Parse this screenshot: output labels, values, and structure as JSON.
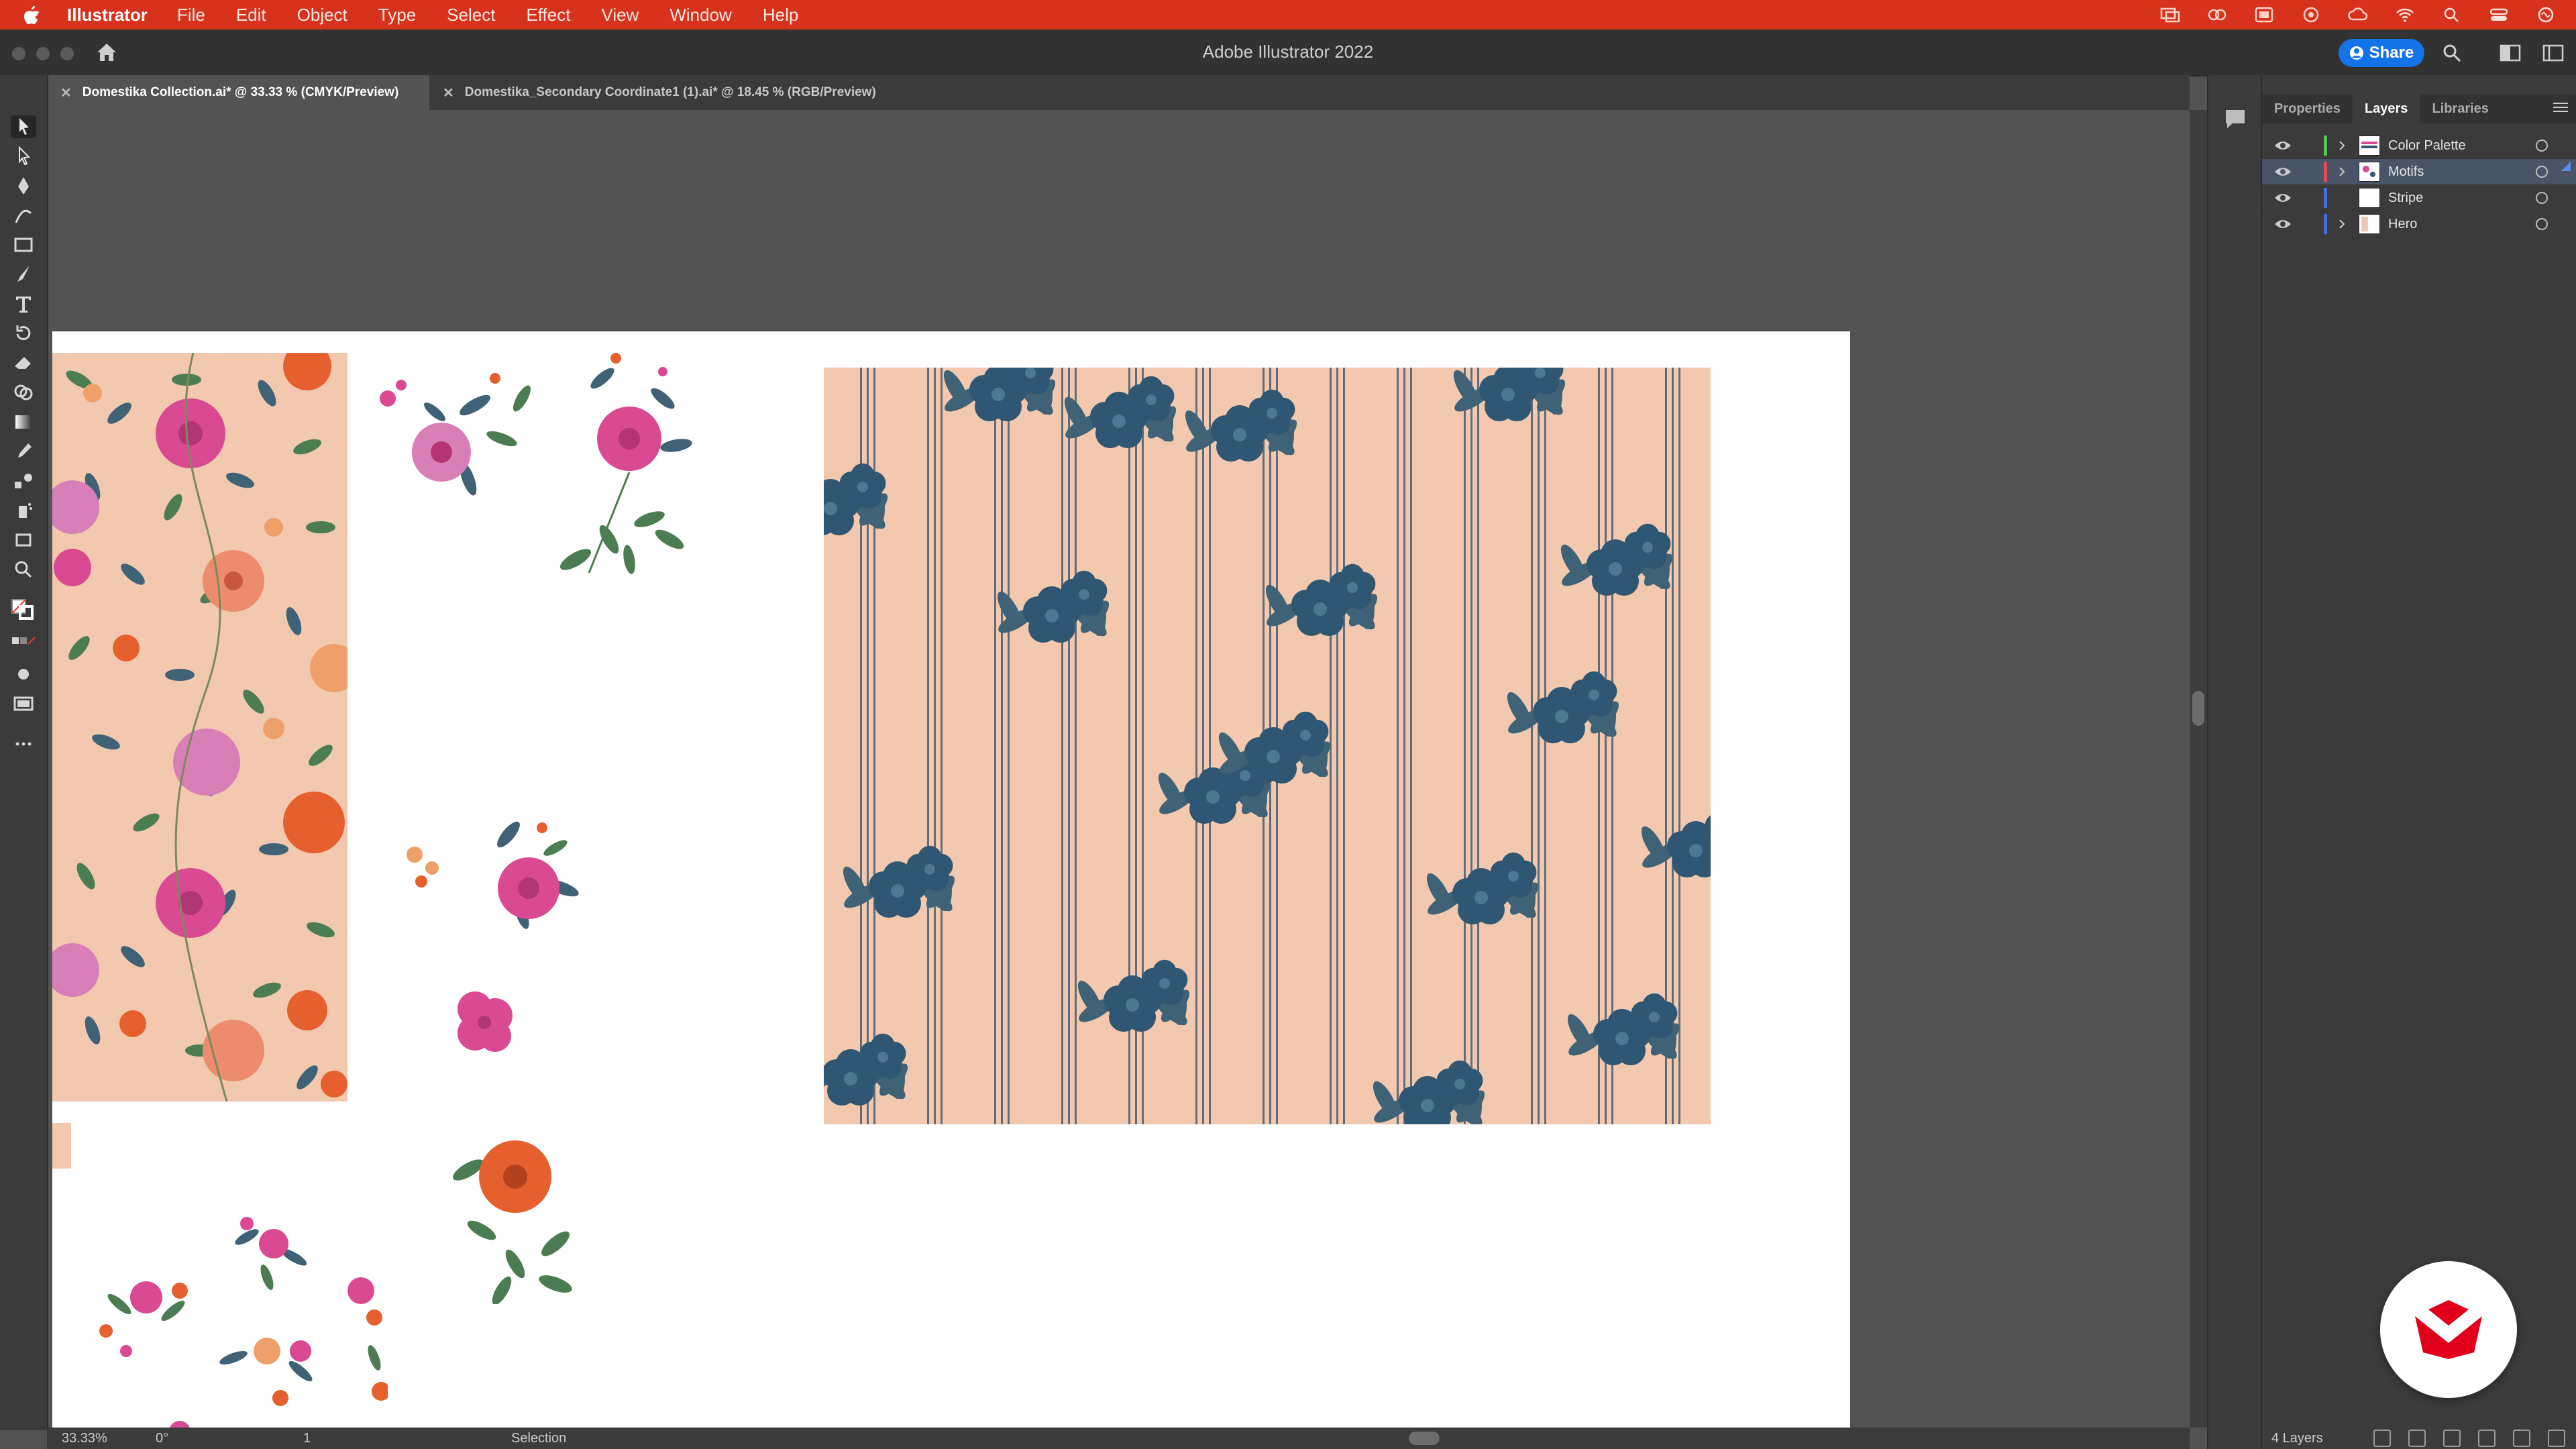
{
  "menubar": {
    "app_name": "Illustrator",
    "items": [
      "File",
      "Edit",
      "Object",
      "Type",
      "Select",
      "Effect",
      "View",
      "Window",
      "Help"
    ]
  },
  "titlebar": {
    "title": "Adobe Illustrator 2022",
    "share_label": "Share"
  },
  "tabs": [
    {
      "label": "Domestika Collection.ai* @ 33.33 % (CMYK/Preview)",
      "active": true
    },
    {
      "label": "Domestika_Secondary Coordinate1 (1).ai* @ 18.45 % (RGB/Preview)",
      "active": false
    }
  ],
  "panel": {
    "tabs": [
      "Properties",
      "Layers",
      "Libraries"
    ],
    "active_tab": "Layers",
    "layers": [
      {
        "name": "Color Palette",
        "color": "#4fc94f",
        "expandable": true,
        "selected": false
      },
      {
        "name": "Motifs",
        "color": "#e04b4b",
        "expandable": true,
        "selected": true
      },
      {
        "name": "Stripe",
        "color": "#3d6fe0",
        "expandable": false,
        "selected": false
      },
      {
        "name": "Hero",
        "color": "#3d6fe0",
        "expandable": true,
        "selected": false
      }
    ],
    "layer_count": "4 Layers"
  },
  "statusbar": {
    "zoom": "33.33%",
    "rotation": "0°",
    "page": "1",
    "tool": "Selection"
  },
  "colors": {
    "menubar": "#d7321b",
    "accent": "#1473e6",
    "peach": "#f2c9ae",
    "navy_flower": "#2f5672",
    "pink_flower": "#d94a93",
    "orange_flower": "#e5602e",
    "leaf_green": "#4c7d52"
  }
}
